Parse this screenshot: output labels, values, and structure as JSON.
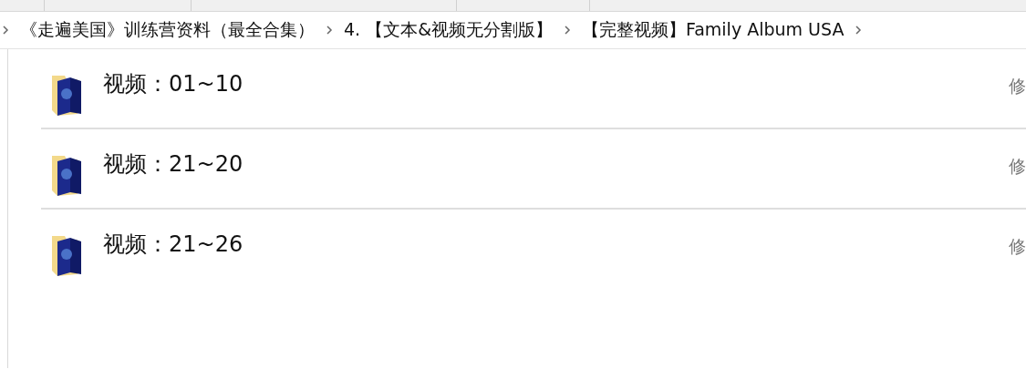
{
  "breadcrumb": [
    {
      "label": "《走遍美国》训练营资料（最全合集）"
    },
    {
      "label": "4. 【文本&视频无分割版】"
    },
    {
      "label": "【完整视频】Family Album USA"
    }
  ],
  "items": [
    {
      "name": "视频：01~10",
      "column_2": "修"
    },
    {
      "name": "视频：21~20",
      "column_2": "修"
    },
    {
      "name": "视频：21~26",
      "column_2": "修"
    }
  ]
}
